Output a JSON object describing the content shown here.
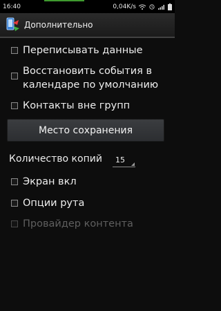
{
  "status_bar": {
    "time": "16:40",
    "net_speed": "0,04K/s",
    "icons": [
      "wifi-icon",
      "alarm-icon",
      "signal-icon",
      "battery-icon"
    ]
  },
  "action_bar": {
    "title": "Дополнительно",
    "icon": "sync-app-icon"
  },
  "options": [
    {
      "label": "Переписывать данные",
      "checked": false,
      "enabled": true
    },
    {
      "label": "Восстановить события в",
      "label2": "календаре по умолчанию",
      "checked": false,
      "enabled": true
    },
    {
      "label": "Контакты вне групп",
      "checked": false,
      "enabled": true
    }
  ],
  "save_location_button": "Место сохранения",
  "copies": {
    "label": "Количество копий",
    "value": "15"
  },
  "options2": [
    {
      "label": "Экран вкл",
      "checked": false,
      "enabled": true
    },
    {
      "label": "Опции рута",
      "checked": false,
      "enabled": true
    },
    {
      "label": "Провайдер контента",
      "checked": false,
      "enabled": false
    }
  ],
  "colors": {
    "background": "#0d0d0d",
    "text": "#eeeeee",
    "disabled_text": "#5f5f5f",
    "accent_green": "#3f9a2f"
  }
}
